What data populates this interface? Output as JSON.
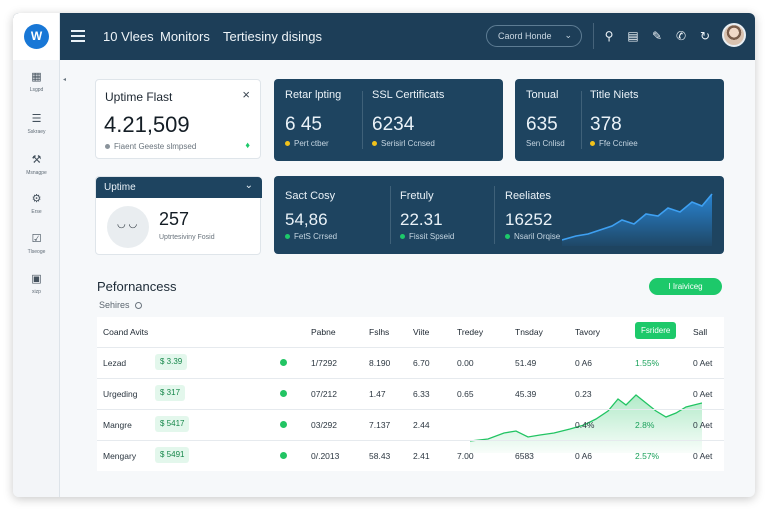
{
  "topbar": {
    "logo_letter": "W",
    "title_parts": [
      "10 Vlees",
      "Monitors",
      "Tertiesiny disings"
    ],
    "search_label": "Caord Honde",
    "icons": [
      "search-icon",
      "document-icon",
      "pin-icon",
      "phone-icon",
      "refresh-icon"
    ]
  },
  "sidebar": {
    "items": [
      {
        "icon": "dashboard-icon",
        "label": "Lsgpd"
      },
      {
        "icon": "list-icon",
        "label": "Sskraey"
      },
      {
        "icon": "tool-icon",
        "label": "Msnagpe"
      },
      {
        "icon": "monitor-icon",
        "label": "Erse"
      },
      {
        "icon": "chart-icon",
        "label": "Tlseoge"
      },
      {
        "icon": "report-icon",
        "label": "xizp"
      }
    ]
  },
  "cards": {
    "uptime_flast": {
      "title": "Uptime Flast",
      "value": "4.21,509",
      "note": "Fiaent Geeste slmpsed",
      "close": "×"
    },
    "retar": {
      "title": "Retar lpting",
      "value": "6 45",
      "note": "Pert ctber"
    },
    "ssl": {
      "title": "SSL Certificats",
      "value": "6234",
      "note": "Serisirl Ccnsed"
    },
    "tonual": {
      "title": "Tonual",
      "value": "635",
      "note": "Sen Cnlisd"
    },
    "title_niets": {
      "title": "Title Niets",
      "value": "378",
      "note": "Ffe Ccniee"
    },
    "uptime": {
      "title": "Uptime",
      "value": "257",
      "note": "Uptrtesiviny Fosid"
    },
    "sact": {
      "title": "Sact Cosy",
      "value": "54,86",
      "note": "FetS Crrsed"
    },
    "fretuly": {
      "title": "Fretuly",
      "value": "22.31",
      "note": "Fissit Spseid"
    },
    "reeliates": {
      "title": "Reeliates",
      "value": "16252",
      "note": "Nsaril Orqise"
    }
  },
  "colors": {
    "accent_green": "#1dc96a",
    "dark_card": "#1e4460",
    "topbar": "#1d3e58",
    "area_blue": "#2b8fe6"
  },
  "performance": {
    "title": "Pefornancess",
    "subtitle": "Sehires",
    "button": "I Iraiviceg"
  },
  "table": {
    "headers": [
      "Coand Avits",
      "Pabne",
      "Fslhs",
      "Viite",
      "Tredey",
      "Tnsday",
      "Tavory",
      "Fsridere",
      "Sall"
    ],
    "rows": [
      {
        "name": "Lezad",
        "pill": "$ 3.39",
        "c1": "1/7292",
        "c2": "8.190",
        "c3": "6.70",
        "c4": "0.00",
        "c5": "51.49",
        "c6": "0 A6",
        "pct": "1.55%",
        "c7": "0 Aet"
      },
      {
        "name": "Urgeding",
        "pill": "$ 317",
        "c1": "07/212",
        "c2": "1.47",
        "c3": "6.33",
        "c4": "0.65",
        "c5": "45.39",
        "c6": "0.23",
        "pct": "",
        "c7": "0 Aet"
      },
      {
        "name": "Mangre",
        "pill": "$ 5417",
        "c1": "03/292",
        "c2": "7.137",
        "c3": "2.44",
        "c4": "",
        "c5": "",
        "c6": "0.4%",
        "pct": "2.8%",
        "c7": "0 Aet"
      },
      {
        "name": "Mengary",
        "pill": "$ 5491",
        "c1": "0/.2013",
        "c2": "58.43",
        "c3": "2.41",
        "c4": "7.00",
        "c5": "6583",
        "c6": "0 A6",
        "pct": "2.57%",
        "c7": "0 Aet"
      }
    ]
  }
}
